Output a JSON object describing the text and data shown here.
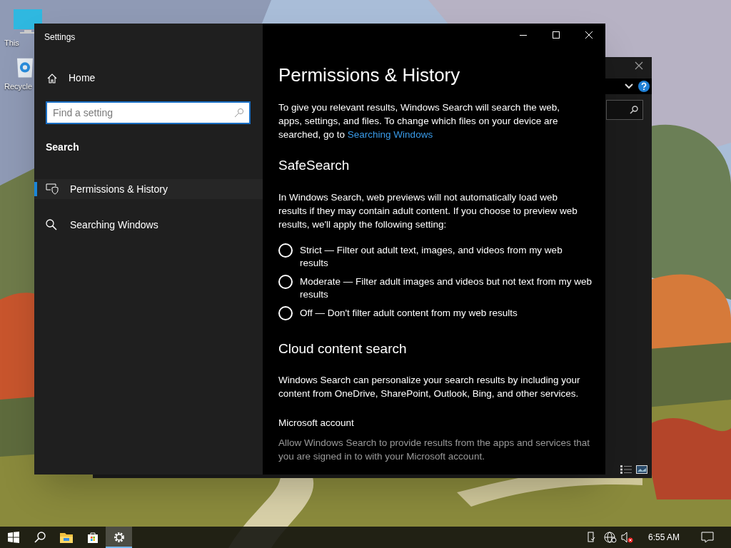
{
  "desktop_icons": [
    {
      "label": "This",
      "kind": "monitor"
    },
    {
      "label": "Recycle",
      "kind": "recycle"
    }
  ],
  "window": {
    "title": "Settings"
  },
  "sidebar": {
    "home": "Home",
    "search": {
      "placeholder": "Find a setting"
    },
    "section": "Search",
    "items": [
      {
        "label": "Permissions & History",
        "kind": "shield",
        "selected": true
      },
      {
        "label": "Searching Windows",
        "kind": "search",
        "selected": false
      }
    ]
  },
  "content": {
    "title": "Permissions & History",
    "intro": "To give you relevant results, Windows Search will search the web, apps, settings, and files. To change which files on your device are searched, go to",
    "intro_link": "Searching Windows",
    "safesearch": {
      "heading": "SafeSearch",
      "description": "In Windows Search, web previews will not automatically load web results if they may contain adult content. If you choose to preview web results, we'll apply the following setting:",
      "options": [
        {
          "label": "Strict — Filter out adult text, images, and videos from my web results",
          "selected": false
        },
        {
          "label": "Moderate — Filter adult images and videos but not text from my web results",
          "selected": false
        },
        {
          "label": "Off — Don't filter adult content from my web results",
          "selected": false
        }
      ]
    },
    "cloud": {
      "heading": "Cloud content search",
      "description": "Windows Search can personalize your search results by including your content from OneDrive, SharePoint, Outlook, Bing, and other services.",
      "subheading": "Microsoft account",
      "subtext": "Allow Windows Search to provide results from the apps and services that you are signed in to with your Microsoft account."
    }
  },
  "taskbar": {
    "apps": [
      {
        "kind": "start",
        "selected": false
      },
      {
        "kind": "search",
        "selected": false
      },
      {
        "kind": "folder",
        "selected": false
      },
      {
        "kind": "store",
        "selected": false
      },
      {
        "kind": "gear",
        "selected": true
      }
    ],
    "time": "6:55 AM"
  }
}
